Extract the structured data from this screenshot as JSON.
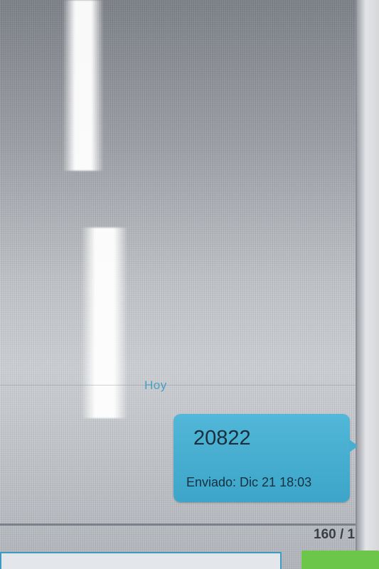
{
  "conversation": {
    "date_divider": "Hoy"
  },
  "messages": [
    {
      "text": "20822",
      "status": "Enviado: Dic 21 18:03",
      "direction": "sent",
      "bubble_color": "#45abd0"
    }
  ],
  "composer": {
    "char_counter": "160 / 1",
    "send_button_color": "#6cc64a"
  },
  "colors": {
    "accent": "#4a9fc1",
    "bubble": "#45abd0",
    "send": "#6cc64a"
  }
}
